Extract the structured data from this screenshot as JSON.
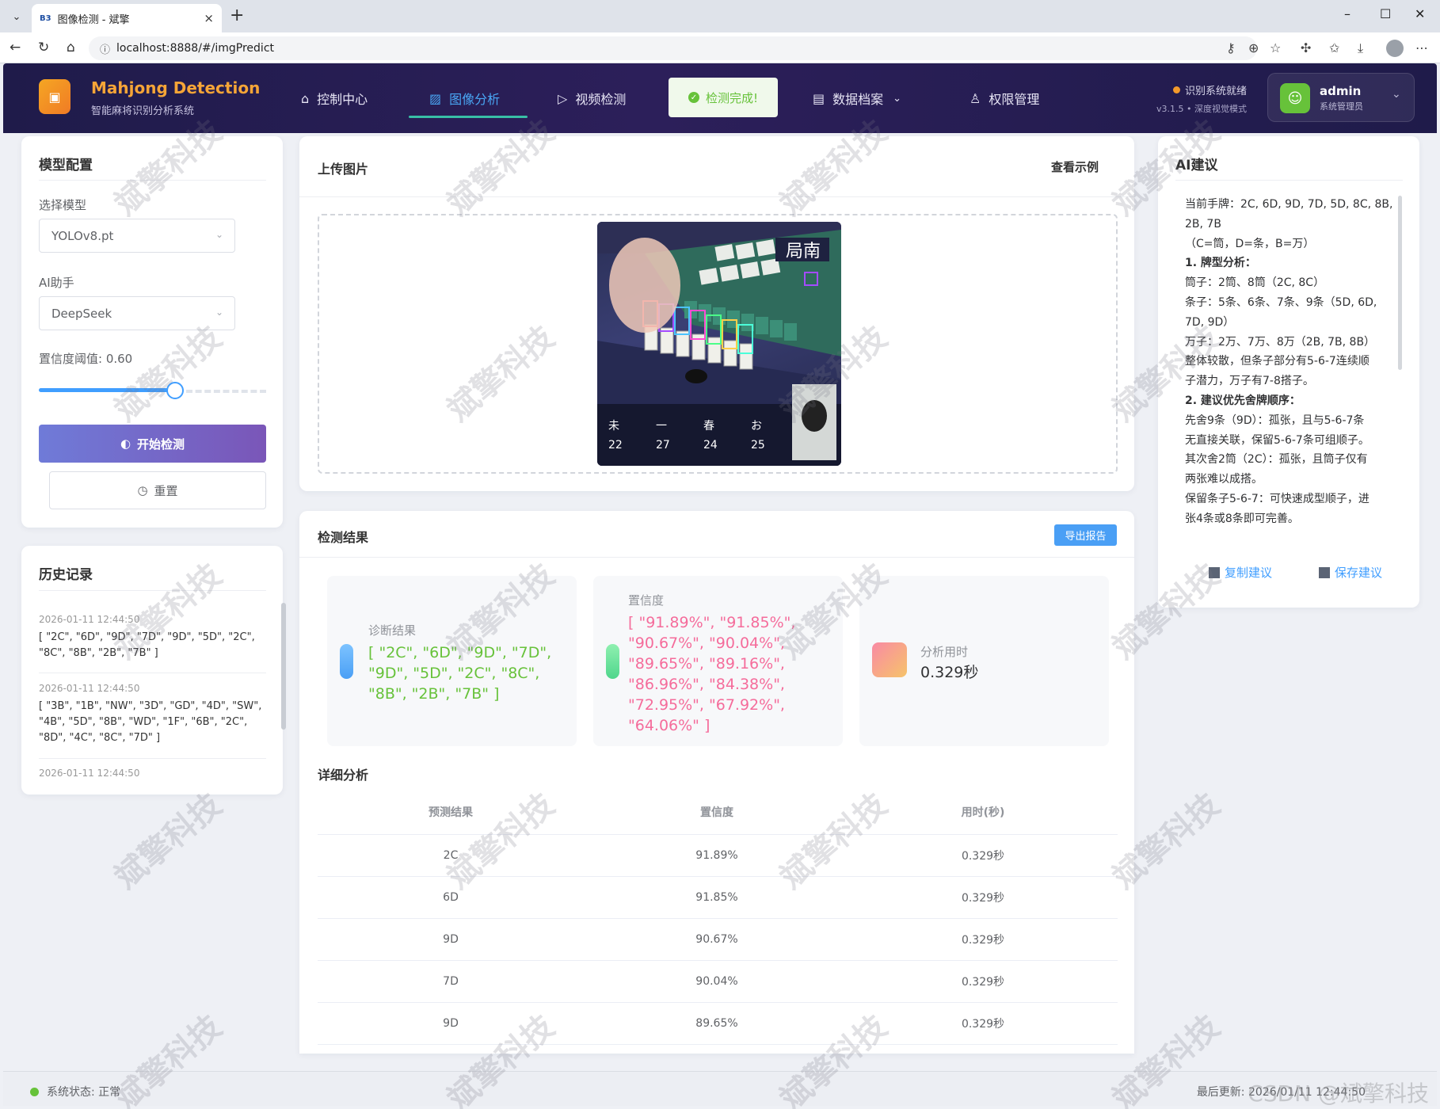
{
  "browser": {
    "tab_title": "图像检测 - 斌擎",
    "tab_favicon": "B3",
    "url": "localhost:8888/#/imgPredict"
  },
  "header": {
    "brand_title_a": "Mahjong",
    "brand_title_b": "Detection",
    "brand_subtitle": "智能麻将识别分析系统",
    "nav": [
      {
        "label": "控制中心",
        "icon": "home-icon"
      },
      {
        "label": "图像分析",
        "icon": "image-icon"
      },
      {
        "label": "视频检测",
        "icon": "play-icon"
      },
      {
        "label": "数据档案",
        "icon": "document-icon"
      },
      {
        "label": "权限管理",
        "icon": "user-icon"
      }
    ],
    "toast": "检测完成!",
    "status_text": "识别系统就绪",
    "version_text": "v3.1.5 • 深度视觉模式",
    "user_name": "admin",
    "user_role": "系统管理员"
  },
  "config": {
    "title": "模型配置",
    "model_label": "选择模型",
    "model_value": "YOLOv8.pt",
    "ai_label": "AI助手",
    "ai_value": "DeepSeek",
    "confidence_label": "置信度阈值: 0.60",
    "confidence_value": 0.6,
    "start_button": "开始检测",
    "reset_button": "重置"
  },
  "history": {
    "title": "历史记录",
    "items": [
      {
        "time": "2026-01-11 12:44:50",
        "values": "[ \"2C\", \"6D\", \"9D\", \"7D\", \"9D\", \"5D\", \"2C\", \"8C\", \"8B\", \"2B\", \"7B\" ]"
      },
      {
        "time": "2026-01-11 12:44:50",
        "values": "[ \"3B\", \"1B\", \"NW\", \"3D\", \"GD\", \"4D\", \"SW\", \"4B\", \"5D\", \"8B\", \"WD\", \"1F\", \"6B\", \"2C\", \"8D\", \"4C\", \"8C\", \"7D\" ]"
      },
      {
        "time": "2026-01-11 12:44:50",
        "values": ""
      }
    ]
  },
  "upload": {
    "title": "上传图片",
    "example_link": "查看示例",
    "image_overlay_text": "局南"
  },
  "results": {
    "title": "检测结果",
    "export_button": "导出报告",
    "diagnosis_label": "诊断结果",
    "diagnosis_value": "[ \"2C\", \"6D\", \"9D\", \"7D\", \"9D\", \"5D\", \"2C\", \"8C\", \"8B\", \"2B\", \"7B\" ]",
    "confidence_label": "置信度",
    "confidence_value": "[ \"91.89%\", \"91.85%\", \"90.67%\", \"90.04%\", \"89.65%\", \"89.16%\", \"86.96%\", \"84.38%\", \"72.95%\", \"67.92%\", \"64.06%\" ]",
    "time_label": "分析用时",
    "time_value": "0.329秒",
    "detail_title": "详细分析",
    "columns": [
      "预测结果",
      "置信度",
      "用时(秒)"
    ],
    "rows": [
      [
        "2C",
        "91.89%",
        "0.329秒"
      ],
      [
        "6D",
        "91.85%",
        "0.329秒"
      ],
      [
        "9D",
        "90.67%",
        "0.329秒"
      ],
      [
        "7D",
        "90.04%",
        "0.329秒"
      ],
      [
        "9D",
        "89.65%",
        "0.329秒"
      ]
    ],
    "colors": {
      "diagnosis": "#67c23a",
      "confidence": "#f56c9b",
      "accent_blue": "#409eff"
    }
  },
  "ai": {
    "title": "AI建议",
    "lines": [
      "当前手牌：2C, 6D, 9D, 7D, 5D, 8C, 8B,",
      "2B, 7B",
      "（C=筒，D=条，B=万）",
      "1. 牌型分析：",
      "筒子：2筒、8筒（2C, 8C）",
      "条子：5条、6条、7条、9条（5D, 6D,",
      "7D, 9D）",
      "万子：2万、7万、8万（2B, 7B, 8B）",
      "整体较散，但条子部分有5-6-7连续顺",
      "子潜力，万子有7-8搭子。",
      "2. 建议优先舍牌顺序：",
      "先舍9条（9D）：孤张，且与5-6-7条",
      "无直接关联，保留5-6-7条可组顺子。",
      "其次舍2筒（2C）：孤张，且筒子仅有",
      "两张难以成搭。",
      "保留条子5-6-7：可快速成型顺子，进",
      "张4条或8条即可完善。"
    ],
    "copy_button": "复制建议",
    "save_button": "保存建议"
  },
  "statusbar": {
    "status": "系统状态: 正常",
    "updated": "最后更新: 2026/01/11 12:44:50",
    "watermark_site": "CSDN @斌擎科技"
  },
  "watermark": "斌擎科技"
}
